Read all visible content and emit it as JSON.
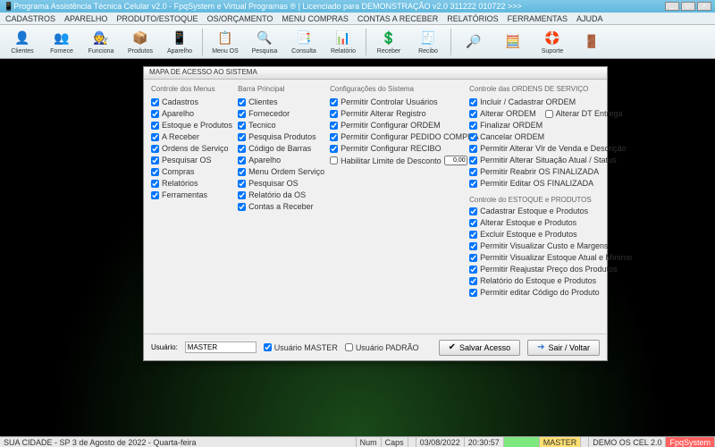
{
  "title": "Programa Assistência Técnica Celular v2.0 - FpqSystem e Virtual Programas ® | Licenciado para  DEMONSTRAÇÃO v2.0 311222 010722 >>>",
  "menus": [
    "CADASTROS",
    "APARELHO",
    "PRODUTO/ESTOQUE",
    "OS/ORÇAMENTO",
    "MENU COMPRAS",
    "CONTAS A RECEBER",
    "RELATÓRIOS",
    "FERRAMENTAS",
    "AJUDA"
  ],
  "toolbar": [
    {
      "label": "Clientes",
      "icon": "👤"
    },
    {
      "label": "Fornece",
      "icon": "👥"
    },
    {
      "label": "Funciona",
      "icon": "🧑‍🔧"
    },
    {
      "label": "Produtos",
      "icon": "📦"
    },
    {
      "label": "Aparelho",
      "icon": "📱"
    },
    {
      "label": "Menu OS",
      "icon": "📋"
    },
    {
      "label": "Pesquisa",
      "icon": "🔍"
    },
    {
      "label": "Consulta",
      "icon": "📑"
    },
    {
      "label": "Relatório",
      "icon": "📊"
    },
    {
      "label": "Receber",
      "icon": "💲"
    },
    {
      "label": "Recibo",
      "icon": "🧾"
    },
    {
      "label": "",
      "icon": "🔎"
    },
    {
      "label": "",
      "icon": "🧮"
    },
    {
      "label": "Suporte",
      "icon": "🛟"
    },
    {
      "label": "",
      "icon": "🚪"
    }
  ],
  "dialog": {
    "title": "MAPA DE ACESSO AO SISTEMA",
    "col1": {
      "head": "Controle dos Menus",
      "items": [
        "Cadastros",
        "Aparelho",
        "Estoque e Produtos",
        "A Receber",
        "Ordens de Serviço",
        "Pesquisar OS",
        "Compras",
        "Relatórios",
        "Ferramentas"
      ]
    },
    "col2": {
      "head": "Barra Principal",
      "items": [
        "Clientes",
        "Fornecedor",
        "Tecnico",
        "Pesquisa Produtos",
        "Código de Barras",
        "Aparelho",
        "Menu Ordem Serviço",
        "Pesquisar OS",
        "Relatório da OS",
        "Contas a Receber"
      ]
    },
    "col3": {
      "head": "Configurações do Sistema",
      "items": [
        "Permitir Controlar Usuários",
        "Permitir Alterar Registro",
        "Permitir Configurar ORDEM",
        "Permitir Configurar PEDIDO COMPRA",
        "Permitir Configurar RECIBO"
      ],
      "limit_label": "Habilitar Limite de Desconto",
      "limit_value": "0,00",
      "limit_suffix": "%"
    },
    "col4a": {
      "head": "Controle das ORDENS DE SERVIÇO",
      "items": [
        "Incluir / Cadastrar ORDEM",
        "Alterar ORDEM",
        "Finalizar ORDEM",
        "Cancelar ORDEM",
        "Permitir Alterar Vlr de Venda e Descrição",
        "Permitir Alterar Situação Atual / Status",
        "Permitir Reabrir OS FINALIZADA",
        "Permitir Editar OS FINALIZADA"
      ],
      "extra": "Alterar DT Entrega"
    },
    "col4b": {
      "head": "Controle do ESTOQUE e PRODUTOS",
      "items": [
        "Cadastrar Estoque e Produtos",
        "Alterar Estoque e Produtos",
        "Excluir Estoque e Produtos",
        "Permitir Visualizar Custo e Margens",
        "Permitir Visualizar Estoque Atual e Mínimo",
        "Permitir Reajustar Preço dos Produtos",
        "Relatório do Estoque e Produtos",
        "Permitir editar Código do Produto"
      ]
    },
    "footer": {
      "user_label": "Usuário:",
      "user_value": "MASTER",
      "master_label": "Usuário MASTER",
      "padrao_label": "Usuário PADRÃO",
      "save": "Salvar Acesso",
      "back": "Sair / Voltar"
    }
  },
  "status": {
    "left": "SUA CIDADE - SP   3 de Agosto de 2022  -  Quarta-feira",
    "num": "Num",
    "caps": "Caps",
    "date": "03/08/2022",
    "time": "20:30:57",
    "master": "MASTER",
    "demo": "DEMO OS CEL 2.0",
    "brand": "FpqSystem"
  }
}
